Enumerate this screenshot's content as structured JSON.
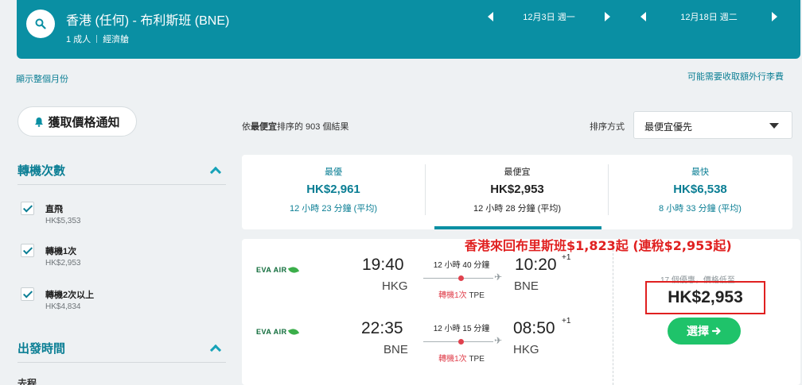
{
  "search": {
    "route": "香港 (任何) - 布利斯班 (BNE)",
    "passengers": "1 成人",
    "cabin": "經濟艙",
    "depart_date": "12月3日 週一",
    "return_date": "12月18日 週二",
    "icon": "search-icon"
  },
  "links": {
    "show_month": "顯示整個月份",
    "baggage_fees": "可能需要收取額外行李費"
  },
  "sidebar": {
    "alert_button": "獲取價格通知",
    "stops_title": "轉機次數",
    "stops": [
      {
        "label": "直飛",
        "price": "HK$5,353",
        "checked": true
      },
      {
        "label": "轉機1次",
        "price": "HK$2,953",
        "checked": true
      },
      {
        "label": "轉機2次以上",
        "price": "HK$4,834",
        "checked": true
      }
    ],
    "departure_title": "出發時間",
    "departure_cut": "去程"
  },
  "results": {
    "count_prefix": "依",
    "count_bold": "最便宜",
    "count_suffix": "排序的 903 個結果",
    "sort_label": "排序方式",
    "sort_value": "最便宜優先"
  },
  "tabs": [
    {
      "label": "最優",
      "price": "HK$2,961",
      "duration": "12 小時 23 分鐘 (平均)",
      "active": false
    },
    {
      "label": "最便宜",
      "price": "HK$2,953",
      "duration": "12 小時 28 分鐘 (平均)",
      "active": true
    },
    {
      "label": "最快",
      "price": "HK$6,538",
      "duration": "8 小時 33 分鐘 (平均)",
      "active": false
    }
  ],
  "card": {
    "outbound": {
      "airline": "EVA AIR",
      "depart_time": "19:40",
      "depart_code": "HKG",
      "arrive_time": "10:20",
      "arrive_offset": "+1",
      "arrive_code": "BNE",
      "duration": "12 小時 40 分鐘",
      "stops_red": "轉機1次",
      "via": "TPE"
    },
    "inbound": {
      "airline": "EVA AIR",
      "depart_time": "22:35",
      "depart_code": "BNE",
      "arrive_time": "08:50",
      "arrive_offset": "+1",
      "arrive_code": "HKG",
      "duration": "12 小時 15 分鐘",
      "stops_red": "轉機1次",
      "via": "TPE"
    },
    "offers": "17 個優惠，價格低至",
    "price": "HK$2,953",
    "select_button": "選擇"
  },
  "promo": "香港來回布里斯班$1,823起 (連稅$2,953起)",
  "colors": {
    "brand": "#0a8fa3",
    "accent_green": "#1fc36a",
    "highlight_red": "#e02020"
  }
}
